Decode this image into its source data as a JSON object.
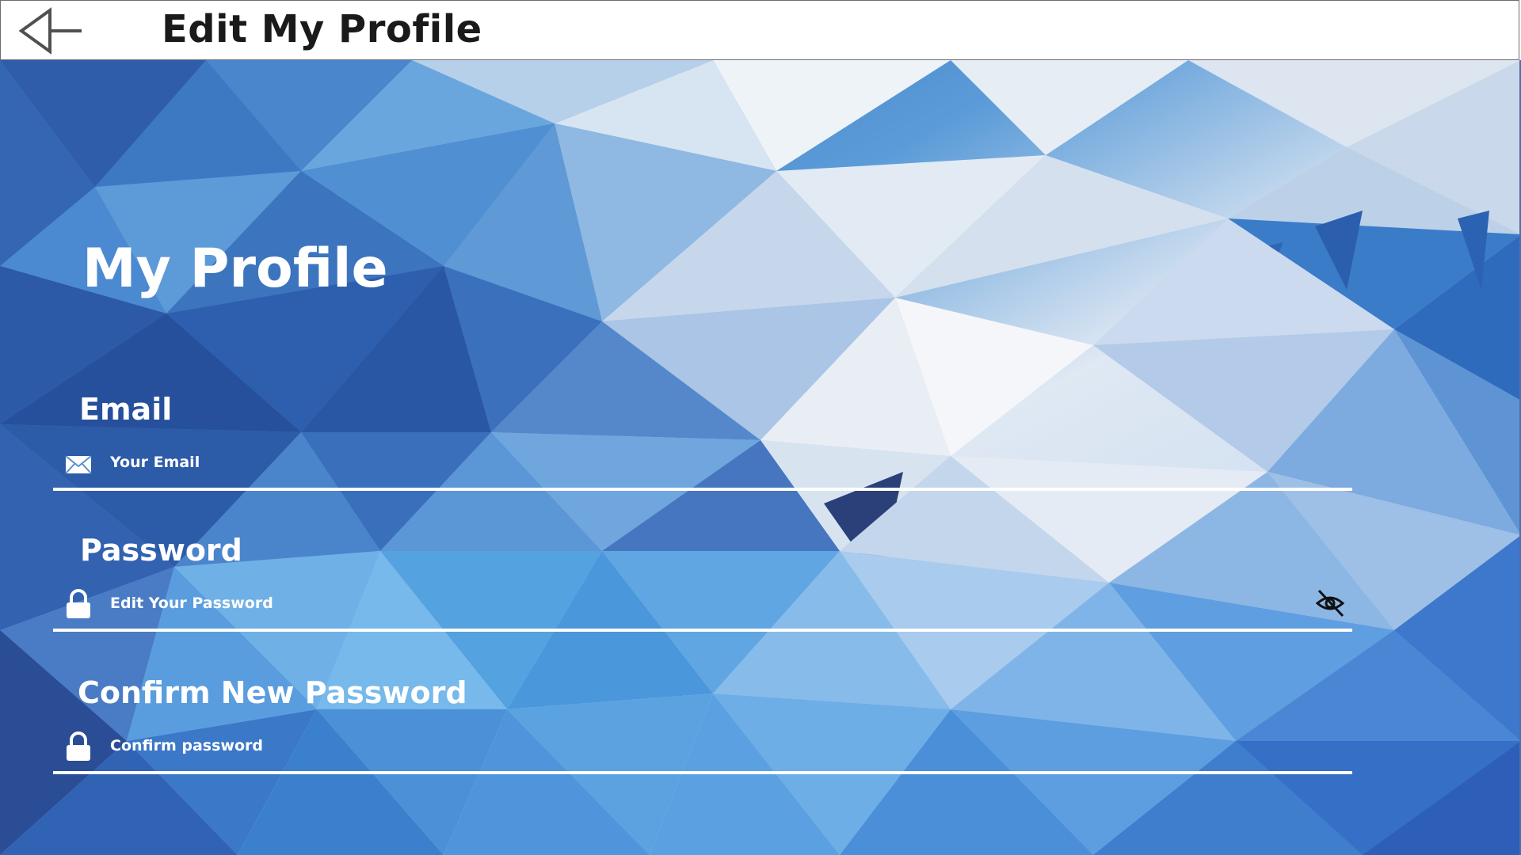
{
  "header": {
    "back_icon": "arrow-left-icon",
    "title": "Edit My Profile"
  },
  "profile": {
    "heading": "My Profile"
  },
  "fields": {
    "email": {
      "label": "Email",
      "icon": "envelope-icon",
      "placeholder": "Your Email",
      "value": ""
    },
    "password": {
      "label": "Password",
      "icon": "lock-icon",
      "placeholder": "Edit Your Password",
      "value": "",
      "toggle_icon": "eye-off-icon"
    },
    "confirm_password": {
      "label": "Confirm New Password",
      "icon": "lock-icon",
      "placeholder": "Confirm password",
      "value": ""
    }
  },
  "colors": {
    "text_on_background": "#ffffff",
    "header_text": "#1a1a1a",
    "background_dark_blue": "#2f5aa8",
    "background_light": "#e6ecf5"
  }
}
